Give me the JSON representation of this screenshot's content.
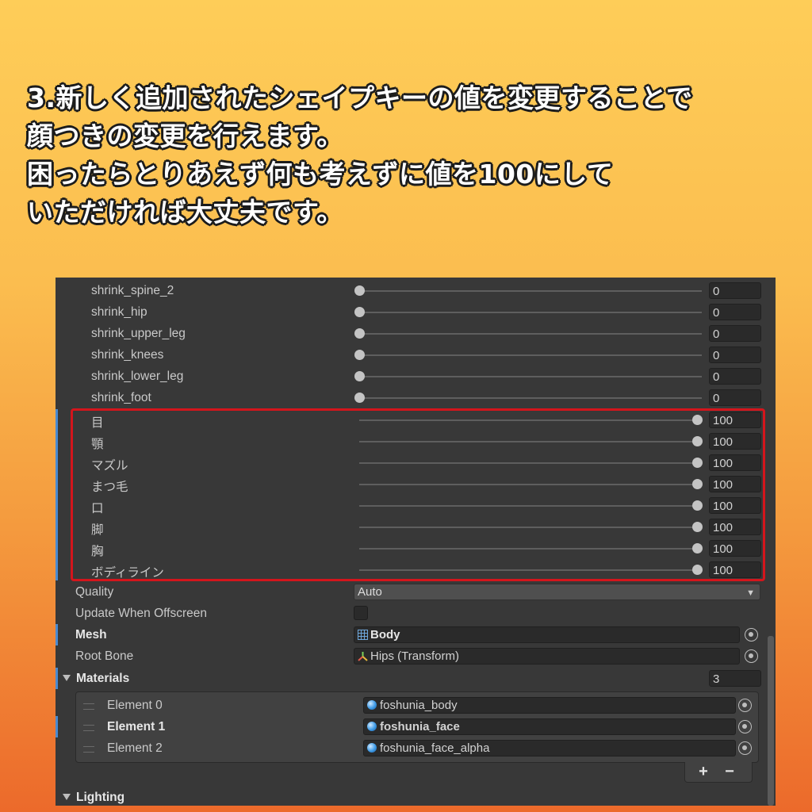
{
  "caption": {
    "lines": [
      "3.新しく追加されたシェイプキーの値を変更することで",
      "顔つきの変更を行えます。",
      "困ったらとりあえず何も考えずに値を100にして",
      "いただければ大丈夫です。"
    ]
  },
  "blendshapes": [
    {
      "name": "shrink_spine_2",
      "value": "0"
    },
    {
      "name": "shrink_hip",
      "value": "0"
    },
    {
      "name": "shrink_upper_leg",
      "value": "0"
    },
    {
      "name": "shrink_knees",
      "value": "0"
    },
    {
      "name": "shrink_lower_leg",
      "value": "0"
    },
    {
      "name": "shrink_foot",
      "value": "0"
    },
    {
      "name": "目",
      "value": "100"
    },
    {
      "name": "顎",
      "value": "100"
    },
    {
      "name": "マズル",
      "value": "100"
    },
    {
      "name": "まつ毛",
      "value": "100"
    },
    {
      "name": "口",
      "value": "100"
    },
    {
      "name": "脚",
      "value": "100"
    },
    {
      "name": "胸",
      "value": "100"
    },
    {
      "name": "ボディライン",
      "value": "100"
    }
  ],
  "quality": {
    "label": "Quality",
    "value": "Auto"
  },
  "update_offscreen": {
    "label": "Update When Offscreen",
    "checked": false
  },
  "mesh": {
    "label": "Mesh",
    "value": "Body"
  },
  "root_bone": {
    "label": "Root Bone",
    "value": "Hips (Transform)"
  },
  "materials": {
    "label": "Materials",
    "count": "3",
    "elements": [
      {
        "label": "Element 0",
        "value": "foshunia_body"
      },
      {
        "label": "Element 1",
        "value": "foshunia_face"
      },
      {
        "label": "Element 2",
        "value": "foshunia_face_alpha"
      }
    ],
    "add_label": "+",
    "remove_label": "−"
  },
  "lighting": {
    "label": "Lighting"
  },
  "colors": {
    "highlight": "#d4151c",
    "modified_bar": "#4a8ad0",
    "panel_bg": "#383838"
  }
}
